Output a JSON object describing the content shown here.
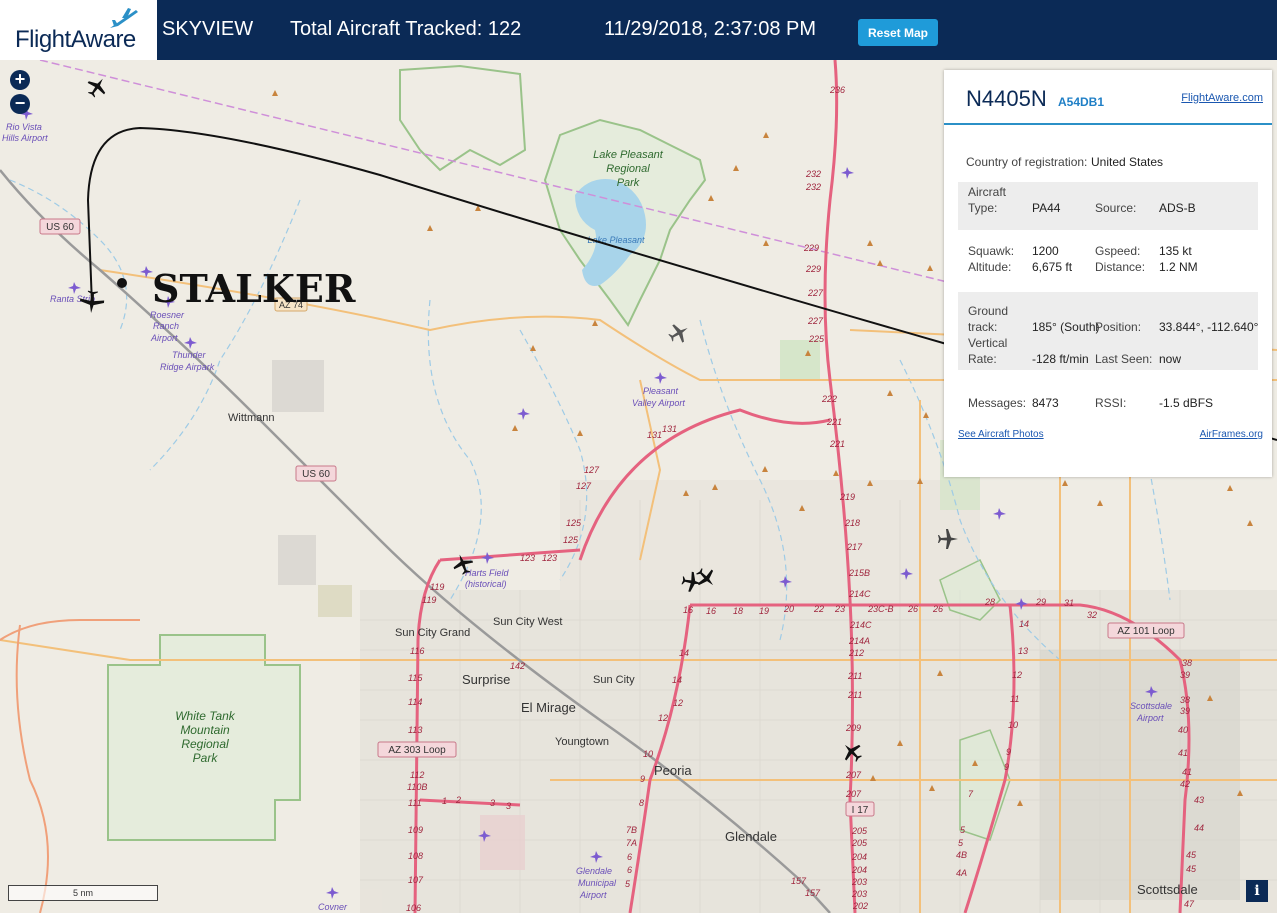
{
  "header": {
    "brand": "FlightAware",
    "app_name": "SKYVIEW",
    "aircraft_count_text": "Total Aircraft Tracked: 122",
    "datetime": "11/29/2018, 2:37:08 PM",
    "reset_label": "Reset Map"
  },
  "map": {
    "zoom_in": "+",
    "zoom_out": "−",
    "receiver_label": "STALKER",
    "scale_label": "5 nm",
    "info_button": "i",
    "places": {
      "rio_vista_1": "Rio Vista",
      "rio_vista_2": "Hills Airport",
      "ranta": "Ranta Strip",
      "roesner_1": "Roesner",
      "roesner_2": "Ranch",
      "roesner_3": "Airport",
      "thunder_1": "Thunder",
      "thunder_2": "Ridge Airpark",
      "wittmann": "Wittmann",
      "lake_park_1": "Lake Pleasant",
      "lake_park_2": "Regional",
      "lake_park_3": "Park",
      "lake": "Lake Pleasant",
      "pv_1": "Pleasant",
      "pv_2": "Valley Airport",
      "harts_1": "Harts Field",
      "harts_2": "(historical)",
      "sun_city_grand": "Sun City Grand",
      "sun_city_west": "Sun City West",
      "surprise": "Surprise",
      "sun_city": "Sun City",
      "el_mirage": "El Mirage",
      "youngtown": "Youngtown",
      "peoria": "Peoria",
      "glendale": "Glendale",
      "glendale_ap_1": "Glendale",
      "glendale_ap_2": "Municipal",
      "glendale_ap_3": "Airport",
      "white_tank_1": "White Tank",
      "white_tank_2": "Mountain",
      "white_tank_3": "Regional",
      "white_tank_4": "Park",
      "scottsdale": "Scottsdale",
      "scottsdale_ap_1": "Scottsdale",
      "scottsdale_ap_2": "Airport",
      "covner": "Covner"
    },
    "shields": {
      "us60_a": "US 60",
      "us60_b": "US 60",
      "az74": "AZ 74",
      "az303": "AZ 303 Loop",
      "az101": "AZ 101 Loop",
      "i17": "I 17"
    }
  },
  "panel": {
    "registration": "N4405N",
    "hex": "A54DB1",
    "fa_link": "FlightAware.com",
    "country_label": "Country of registration:",
    "country": "United States",
    "type_label_1": "Aircraft",
    "type_label_2": "Type:",
    "type": "PA44",
    "source_label": "Source:",
    "source": "ADS-B",
    "squawk_label": "Squawk:",
    "squawk": "1200",
    "altitude_label": "Altitude:",
    "altitude": "6,675 ft",
    "gspeed_label": "Gspeed:",
    "gspeed": "135 kt",
    "distance_label": "Distance:",
    "distance": "1.2 NM",
    "track_label_1": "Ground",
    "track_label_2": "track:",
    "track": "185° (South)",
    "position_label": "Position:",
    "position": "33.844°, -112.640°",
    "vrate_label_1": "Vertical",
    "vrate_label_2": "Rate:",
    "vrate": "-128 ft/min",
    "lastseen_label": "Last Seen:",
    "lastseen": "now",
    "messages_label": "Messages:",
    "messages": "8473",
    "rssi_label": "RSSI:",
    "rssi": "-1.5 dBFS",
    "photos_link": "See Aircraft Photos",
    "airframes_link": "AirFrames.org"
  },
  "colors": {
    "header_bg": "#0b2a56",
    "accent": "#1f9bd9",
    "highway": "#e5627f",
    "secondary_road": "#f3c07a",
    "park_border": "#8cc37a"
  }
}
